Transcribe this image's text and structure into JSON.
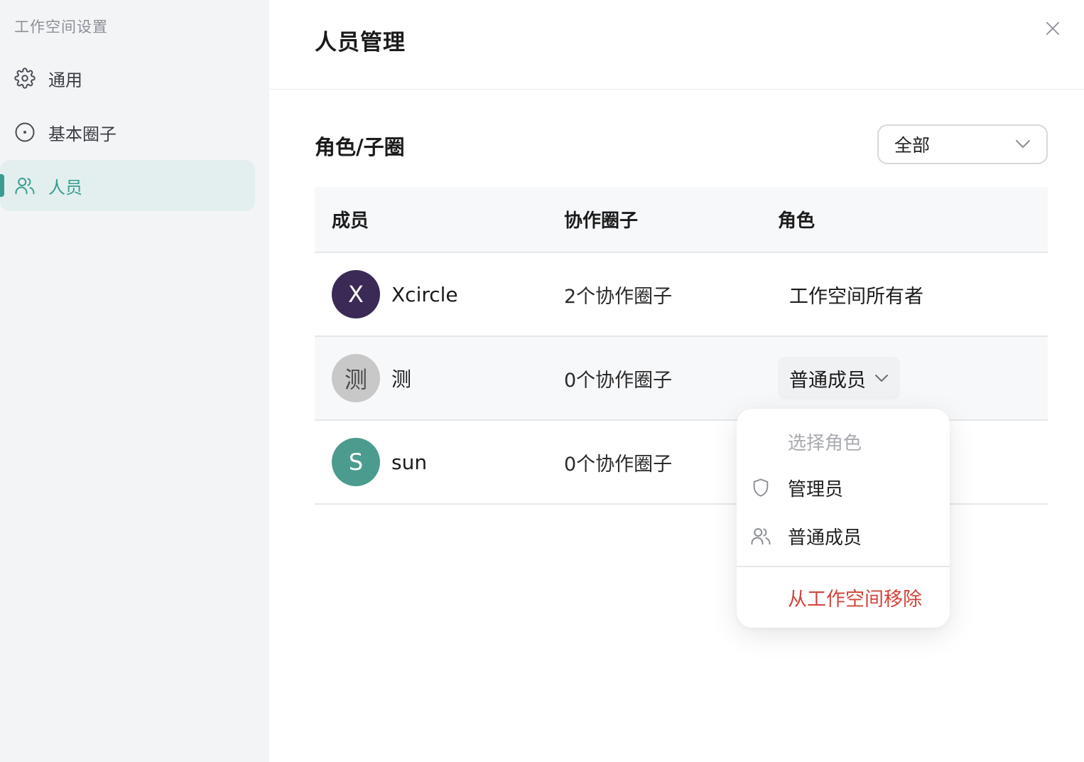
{
  "sidebar": {
    "title": "工作空间设置",
    "items": [
      {
        "label": "通用",
        "icon": "gear-icon"
      },
      {
        "label": "基本圈子",
        "icon": "circle-dot-icon"
      },
      {
        "label": "人员",
        "icon": "users-icon",
        "active": true
      }
    ]
  },
  "main": {
    "title": "人员管理",
    "section_title": "角色/子圈",
    "filter": {
      "selected": "全部"
    },
    "table": {
      "headers": [
        "成员",
        "协作圈子",
        "角色"
      ],
      "rows": [
        {
          "avatar_letter": "X",
          "avatar_color": "#3a2a55",
          "name": "Xcircle",
          "circles": "2个协作圈子",
          "role": "工作空间所有者",
          "role_editable": false
        },
        {
          "avatar_letter": "测",
          "avatar_color": "#c8c8c8",
          "name": "测",
          "circles": "0个协作圈子",
          "role": "普通成员",
          "role_editable": true
        },
        {
          "avatar_letter": "S",
          "avatar_color": "#4b9c8e",
          "name": "sun",
          "circles": "0个协作圈子",
          "role": "",
          "role_editable": true
        }
      ]
    }
  },
  "role_dropdown": {
    "header": "选择角色",
    "options": [
      {
        "label": "管理员",
        "icon": "shield-icon"
      },
      {
        "label": "普通成员",
        "icon": "users-icon"
      }
    ],
    "remove_label": "从工作空间移除",
    "remove_color": "#d1453b"
  },
  "colors": {
    "accent": "#3a9c91",
    "sidebar_bg": "#f3f4f6",
    "active_bg": "#e2efee"
  }
}
